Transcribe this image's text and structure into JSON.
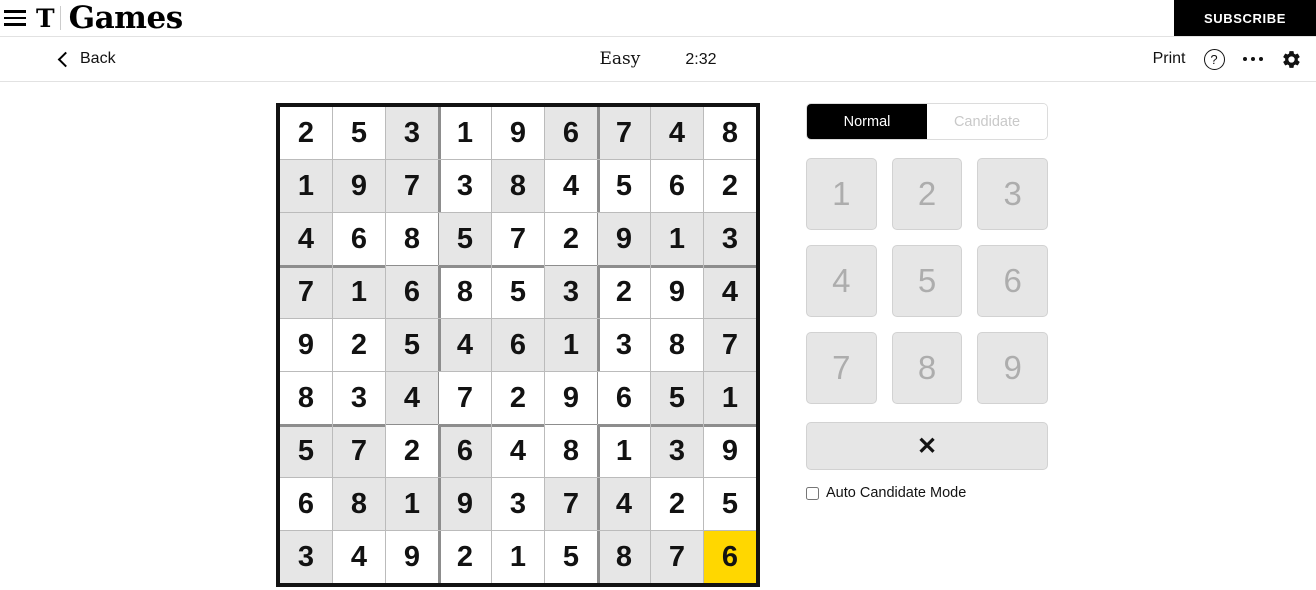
{
  "masthead": {
    "menu_icon": "hamburger-icon",
    "logo": "T",
    "brand": "Games",
    "subscribe_label": "SUBSCRIBE"
  },
  "toolbar": {
    "back_label": "Back",
    "difficulty": "Easy",
    "timer": "2:32",
    "print_label": "Print",
    "help_glyph": "?",
    "more_icon": "more-dots-icon",
    "settings_icon": "gear-icon"
  },
  "controls": {
    "mode_normal": "Normal",
    "mode_candidate": "Candidate",
    "numbers": [
      "1",
      "2",
      "3",
      "4",
      "5",
      "6",
      "7",
      "8",
      "9"
    ],
    "erase_glyph": "✕",
    "auto_candidate_label": "Auto Candidate Mode",
    "auto_candidate_checked": false
  },
  "board": {
    "selected_cell": {
      "row": 8,
      "col": 8
    },
    "selected_color": "#ffd700",
    "given_color": "#e6e6e6",
    "entered_color": "#ffffff",
    "rows": [
      [
        "2",
        "5",
        "3",
        "1",
        "9",
        "6",
        "7",
        "4",
        "8"
      ],
      [
        "1",
        "9",
        "7",
        "3",
        "8",
        "4",
        "5",
        "6",
        "2"
      ],
      [
        "4",
        "6",
        "8",
        "5",
        "7",
        "2",
        "9",
        "1",
        "3"
      ],
      [
        "7",
        "1",
        "6",
        "8",
        "5",
        "3",
        "2",
        "9",
        "4"
      ],
      [
        "9",
        "2",
        "5",
        "4",
        "6",
        "1",
        "3",
        "8",
        "7"
      ],
      [
        "8",
        "3",
        "4",
        "7",
        "2",
        "9",
        "6",
        "5",
        "1"
      ],
      [
        "5",
        "7",
        "2",
        "6",
        "4",
        "8",
        "1",
        "3",
        "9"
      ],
      [
        "6",
        "8",
        "1",
        "9",
        "3",
        "7",
        "4",
        "2",
        "5"
      ],
      [
        "3",
        "4",
        "9",
        "2",
        "1",
        "5",
        "8",
        "7",
        "6"
      ]
    ],
    "given": [
      [
        0,
        0,
        1,
        0,
        0,
        1,
        1,
        1,
        0
      ],
      [
        1,
        1,
        1,
        0,
        1,
        0,
        0,
        0,
        0
      ],
      [
        1,
        0,
        0,
        1,
        0,
        0,
        1,
        1,
        1
      ],
      [
        1,
        1,
        1,
        0,
        0,
        1,
        0,
        0,
        1
      ],
      [
        0,
        0,
        1,
        1,
        1,
        1,
        0,
        0,
        1
      ],
      [
        0,
        0,
        1,
        0,
        0,
        0,
        0,
        1,
        1
      ],
      [
        1,
        1,
        0,
        1,
        0,
        0,
        0,
        1,
        0
      ],
      [
        0,
        1,
        1,
        1,
        0,
        1,
        1,
        0,
        0
      ],
      [
        1,
        0,
        0,
        0,
        0,
        0,
        1,
        1,
        0
      ]
    ]
  }
}
